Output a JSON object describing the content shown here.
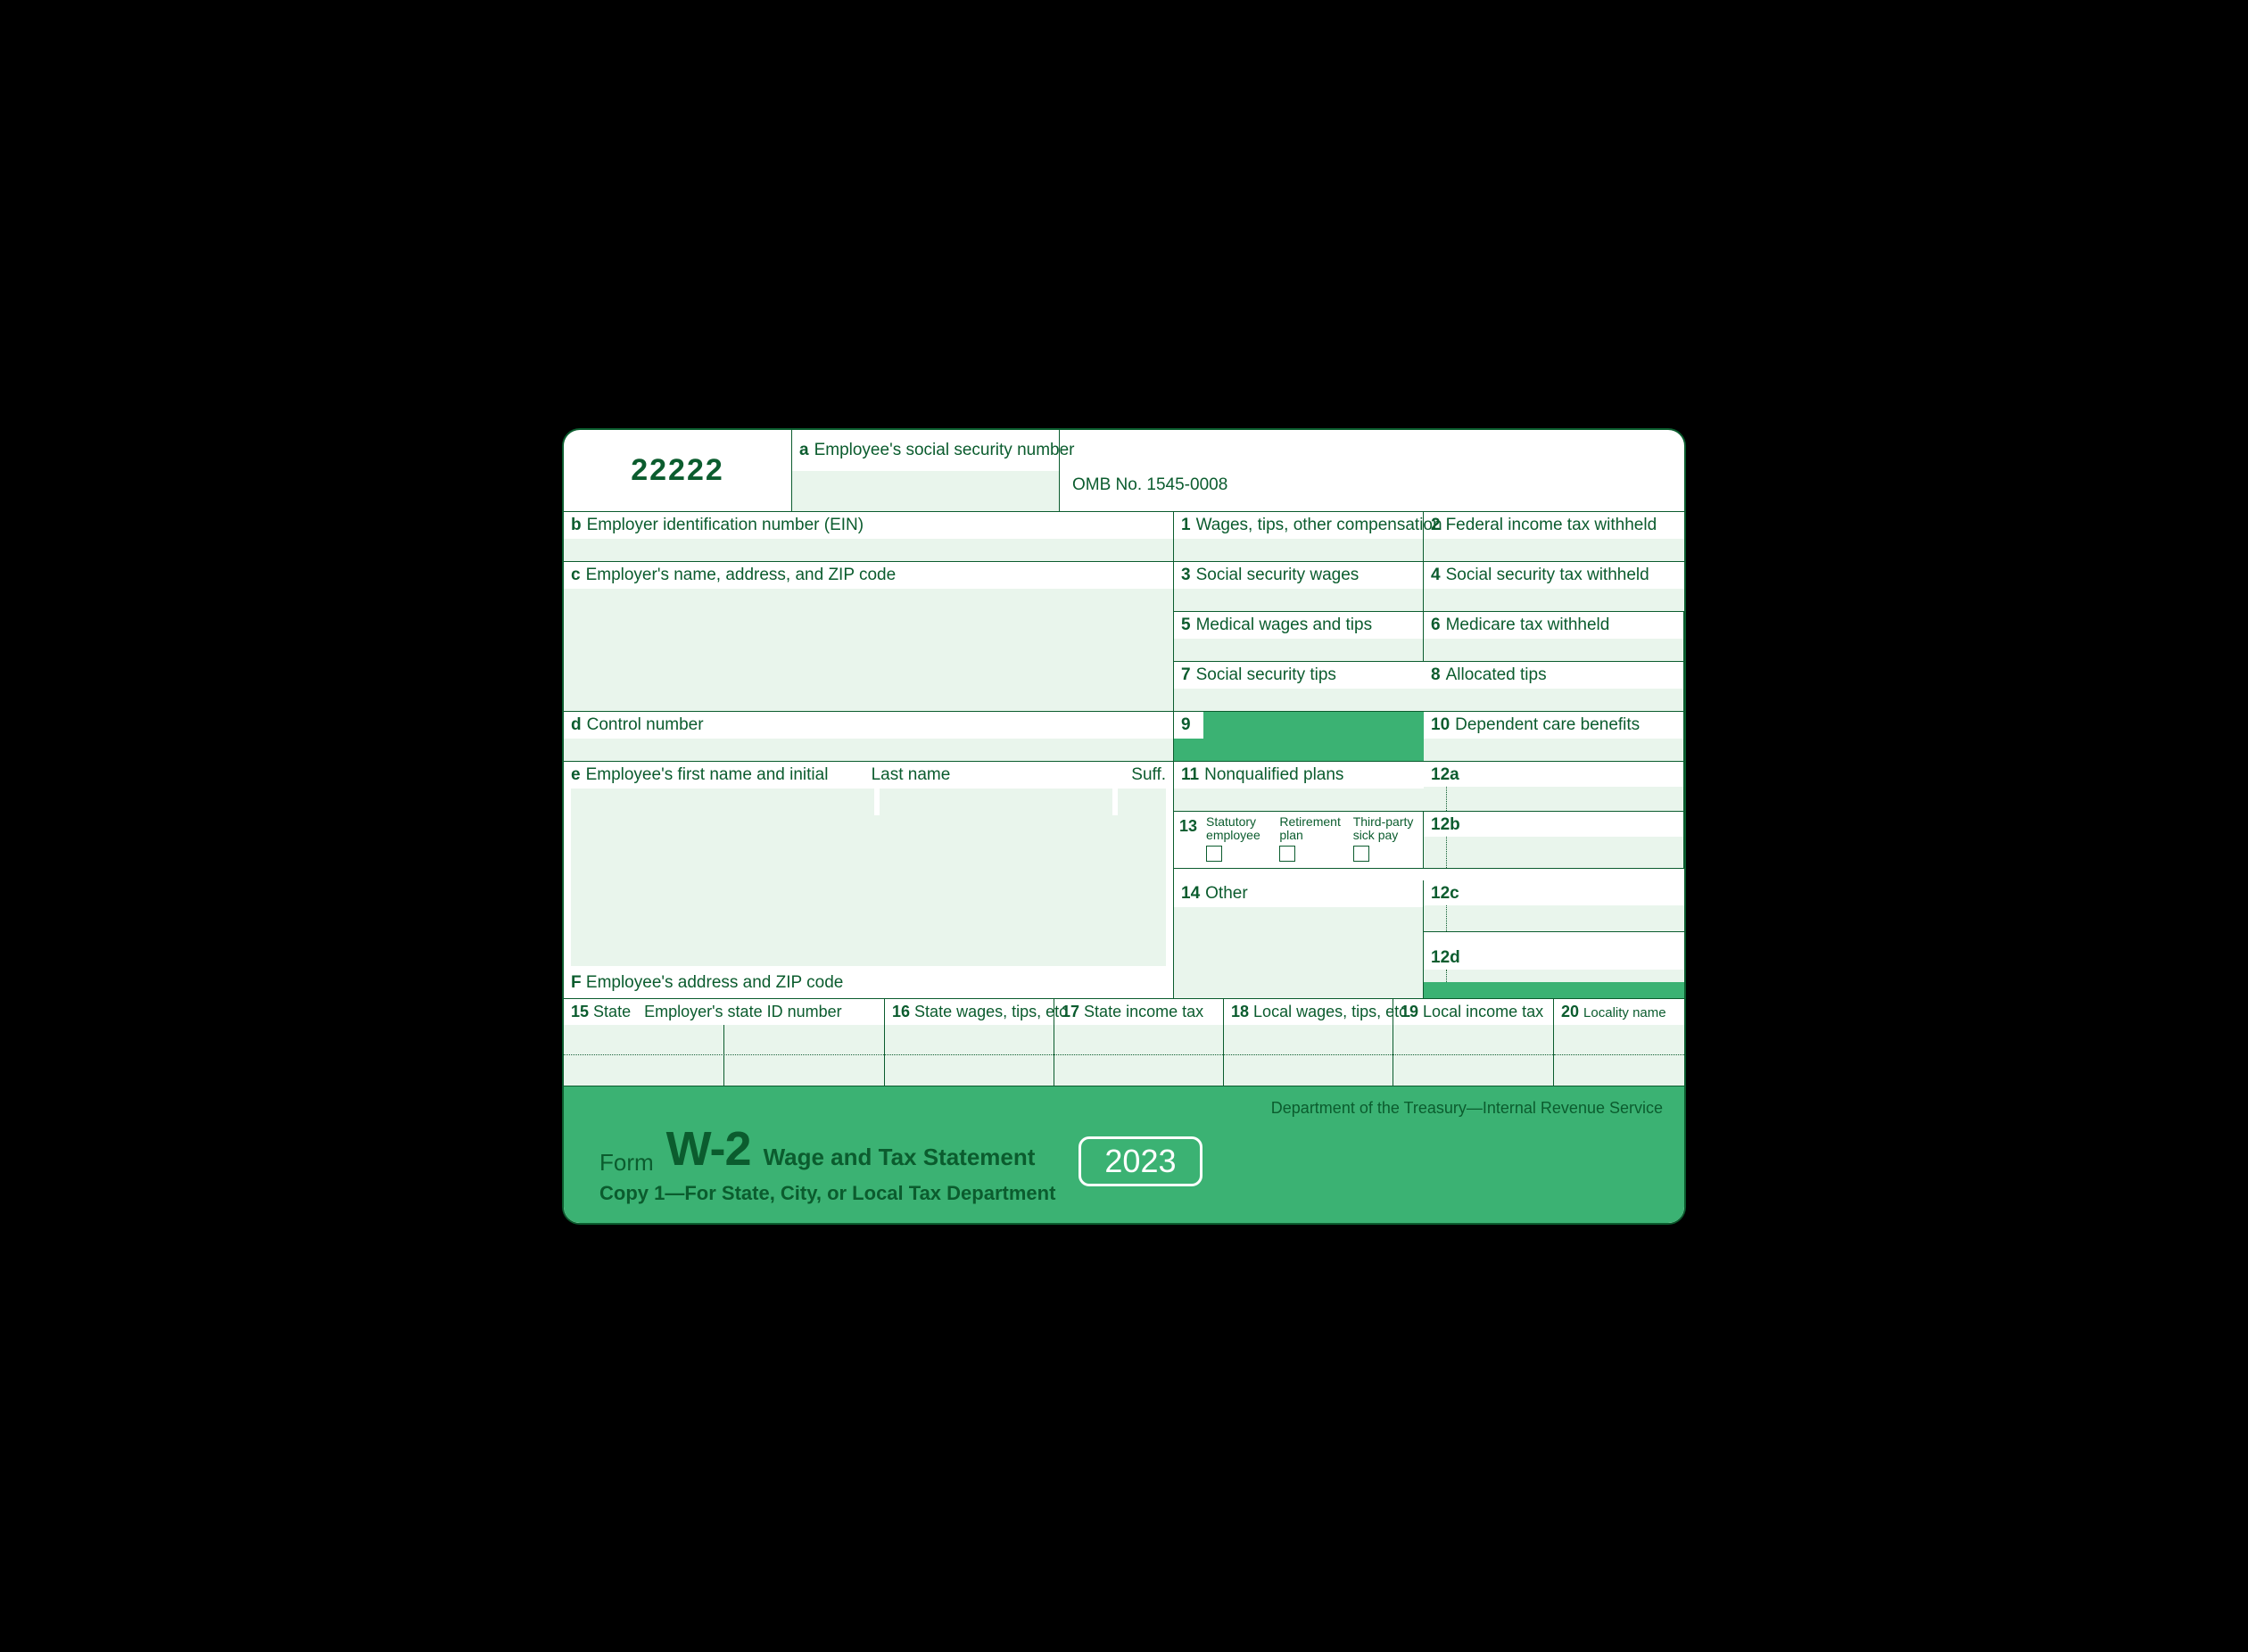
{
  "header": {
    "form_number": "22222",
    "box_a_label": "Employee's social security number",
    "box_a_letter": "a",
    "omb": "OMB No. 1545-0008"
  },
  "left": {
    "b_letter": "b",
    "b_label": "Employer identification number (EIN)",
    "c_letter": "c",
    "c_label": "Employer's name, address, and ZIP code",
    "d_letter": "d",
    "d_label": "Control number",
    "e_letter": "e",
    "e_label": "Employee's first name and initial",
    "e_last": "Last name",
    "e_suff": "Suff.",
    "f_letter": "F",
    "f_label": "Employee's address and ZIP code"
  },
  "boxes": {
    "b1": {
      "n": "1",
      "t": "Wages, tips, other compensation"
    },
    "b2": {
      "n": "2",
      "t": "Federal income tax withheld"
    },
    "b3": {
      "n": "3",
      "t": "Social security wages"
    },
    "b4": {
      "n": "4",
      "t": "Social security tax withheld"
    },
    "b5": {
      "n": "5",
      "t": "Medical wages and tips"
    },
    "b6": {
      "n": "6",
      "t": "Medicare tax withheld"
    },
    "b7": {
      "n": "7",
      "t": "Social security tips"
    },
    "b8": {
      "n": "8",
      "t": "Allocated tips"
    },
    "b9": {
      "n": "9",
      "t": ""
    },
    "b10": {
      "n": "10",
      "t": "Dependent care benefits"
    },
    "b11": {
      "n": "11",
      "t": "Nonqualified plans"
    },
    "b12a": {
      "n": "12a",
      "t": ""
    },
    "b12b": {
      "n": "12b",
      "t": ""
    },
    "b12c": {
      "n": "12c",
      "t": ""
    },
    "b12d": {
      "n": "12d",
      "t": ""
    },
    "b13": {
      "n": "13",
      "c1": "Statutory",
      "c1b": "employee",
      "c2": "Retirement",
      "c2b": "plan",
      "c3": "Third-party",
      "c3b": "sick pay"
    },
    "b14": {
      "n": "14",
      "t": "Other"
    }
  },
  "state": {
    "b15": {
      "n": "15",
      "t": "State",
      "t2": "Employer's state ID number"
    },
    "b16": {
      "n": "16",
      "t": "State wages, tips, etc."
    },
    "b17": {
      "n": "17",
      "t": "State income tax"
    },
    "b18": {
      "n": "18",
      "t": "Local wages, tips, etc."
    },
    "b19": {
      "n": "19",
      "t": "Local income tax"
    },
    "b20": {
      "n": "20",
      "t": "Locality name"
    }
  },
  "footer": {
    "dept": "Department of the Treasury—Internal Revenue Service",
    "form": "Form",
    "name": "W-2",
    "subtitle": "Wage and Tax Statement",
    "copy": "Copy 1—For State, City, or Local Tax Department",
    "year": "2023"
  }
}
